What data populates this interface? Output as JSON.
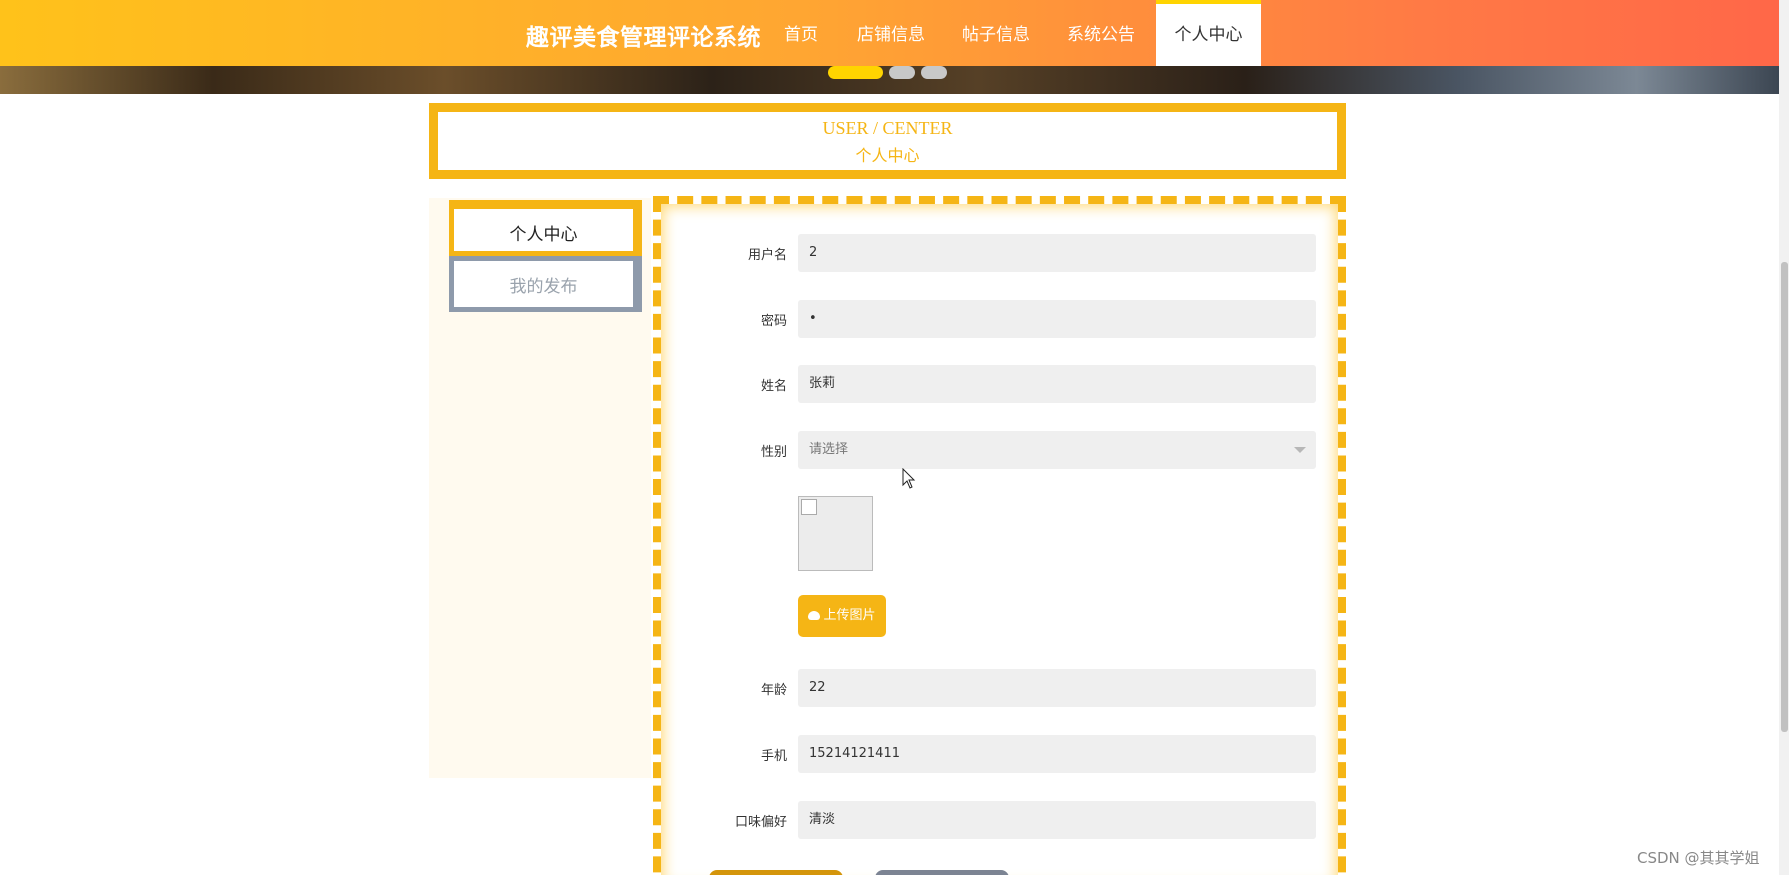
{
  "nav": {
    "brand": "趣评美食管理评论系统",
    "items": [
      {
        "label": "首页"
      },
      {
        "label": "店铺信息"
      },
      {
        "label": "帖子信息"
      },
      {
        "label": "系统公告"
      },
      {
        "label": "个人中心"
      }
    ],
    "active_index": 4,
    "carousel_dots": 3,
    "carousel_active_index": 0
  },
  "header": {
    "title_en": "USER / CENTER",
    "title_cn": "个人中心"
  },
  "sidebar": {
    "items": [
      {
        "label": "个人中心"
      },
      {
        "label": "我的发布"
      }
    ],
    "active_index": 0
  },
  "form": {
    "username": {
      "label": "用户名",
      "value": "2"
    },
    "password": {
      "label": "密码",
      "value": "•"
    },
    "name": {
      "label": "姓名",
      "value": "张莉"
    },
    "gender": {
      "label": "性别",
      "placeholder": "请选择"
    },
    "upload_label": "上传图片",
    "age": {
      "label": "年龄",
      "value": "22"
    },
    "phone": {
      "label": "手机",
      "value": "15214121411"
    },
    "taste": {
      "label": "口味偏好",
      "value": "清淡"
    }
  },
  "watermark": "CSDN @其其学姐",
  "colors": {
    "accent": "#f5b515",
    "accent_dark": "#d4950b",
    "nav_gradient_start": "#ffc21a",
    "nav_gradient_end": "#ff6748",
    "inactive_border": "#8e9aab"
  }
}
